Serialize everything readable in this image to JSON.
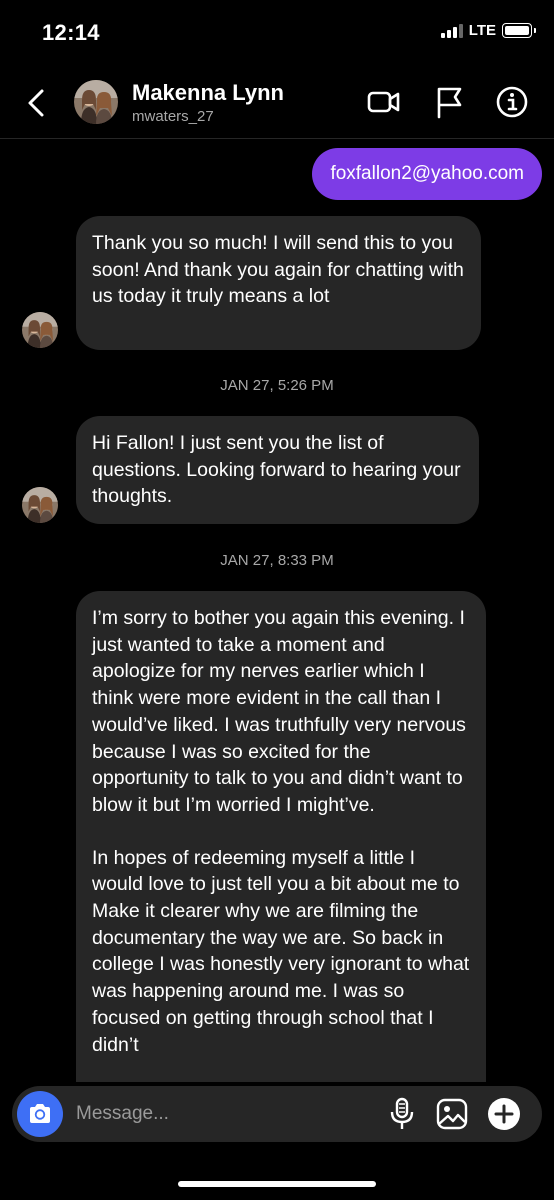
{
  "status_bar": {
    "time": "12:14",
    "network": "LTE"
  },
  "header": {
    "name": "Makenna Lynn",
    "username": "mwaters_27"
  },
  "messages": {
    "outgoing_1": "foxfallon2@yahoo.com",
    "incoming_1": "Thank you so much! I will send this to you soon! And thank you again for chatting with us today it truly means a lot",
    "timestamp_1": "JAN 27, 5:26 PM",
    "incoming_2": "Hi Fallon! I just sent you the list of questions. Looking forward to hearing your thoughts.",
    "timestamp_2": "JAN 27, 8:33 PM",
    "incoming_3_p1": "I’m sorry to bother you again this evening. I just wanted to take a moment and apologize for my nerves earlier which I think were more evident in the call than I would’ve liked. I was truthfully very nervous because I was so excited for the opportunity to talk to you and didn’t want to blow it but I’m worried I might’ve.",
    "incoming_3_p2": "In hopes of redeeming myself a little I would love to just tell you a bit about me to Make it clearer why we are filming the documentary the way we are. So back in college I was honestly very ignorant to what was happening around me. I was so focused on getting through school that I didn’t"
  },
  "composer": {
    "placeholder": "Message..."
  },
  "icons": {
    "back": "back-arrow-icon",
    "video": "video-call-icon",
    "flag": "flag-icon",
    "info": "info-icon",
    "camera": "camera-icon",
    "mic": "microphone-icon",
    "gallery": "gallery-icon",
    "plus": "plus-icon"
  },
  "colors": {
    "background": "#000000",
    "outgoing_bubble": "#7d3ce6",
    "incoming_bubble": "#262626",
    "camera_button": "#3e6ff5",
    "secondary_text": "#a8a8a8"
  }
}
